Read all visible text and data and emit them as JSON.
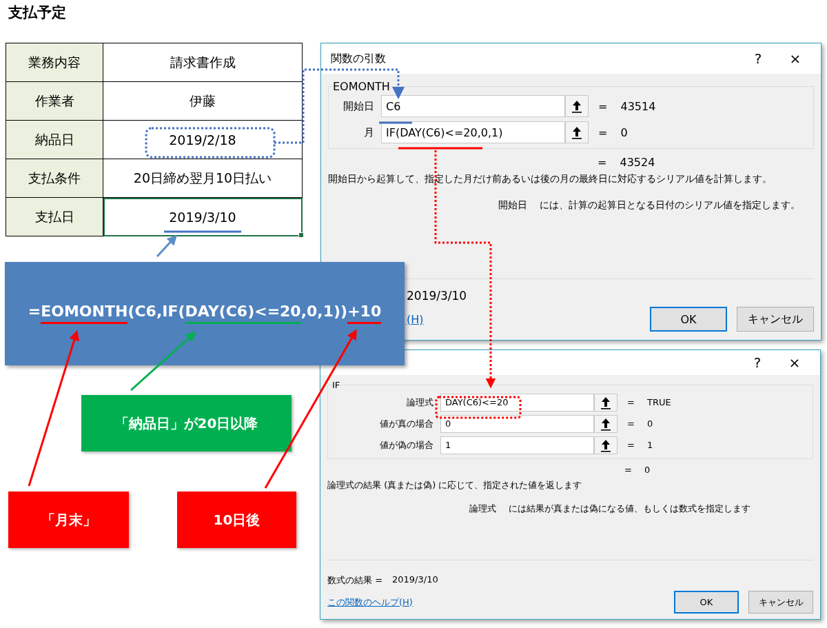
{
  "title": "支払予定",
  "table": {
    "rows": [
      {
        "label": "業務内容",
        "value": "請求書作成",
        "selected": false
      },
      {
        "label": "作業者",
        "value": "伊藤",
        "selected": false
      },
      {
        "label": "納品日",
        "value": "2019/2/18",
        "selected": false
      },
      {
        "label": "支払条件",
        "value": "20日締め翌月10日払い",
        "selected": false
      },
      {
        "label": "支払日",
        "value": "2019/3/10",
        "selected": true
      }
    ]
  },
  "dialogs": [
    {
      "title": "関数の引数",
      "help_mark": "?",
      "close_mark": "×",
      "function": "EOMONTH",
      "args": [
        {
          "label": "開始日",
          "value": "C6",
          "result": "= 43514"
        },
        {
          "label": "月",
          "value": "IF(DAY(C6)<=20,0,1)",
          "result": "= 0"
        }
      ],
      "result": "= 43524",
      "description": "開始日から起算して、指定した月だけ前あるいは後の月の最終日に対応するシリアル値を計算します。",
      "arg_name": "開始日",
      "arg_help": "には、計算の起算日となる日付のシリアル値を指定します。",
      "formula_result": "2019/3/10",
      "help_link": "(H)",
      "buttons": [
        "OK",
        "キャンセル"
      ]
    },
    {
      "help_mark": "?",
      "close_mark": "×",
      "function": "IF",
      "args": [
        {
          "label": "論理式",
          "value": "DAY(C6)<=20",
          "result": "= TRUE"
        },
        {
          "label": "値が真の場合",
          "value": "0",
          "result": "= 0"
        },
        {
          "label": "値が偽の場合",
          "value": "1",
          "result": "= 1"
        }
      ],
      "result": "= 0",
      "description": "論理式の結果 (真または偽) に応じて、指定された値を返します",
      "arg_name": "論理式",
      "arg_help": "には結果が真または偽になる値、もしくは数式を指定します",
      "formula_result_label": "数式の結果 =",
      "formula_result": "2019/3/10",
      "help_link": "この関数のヘルプ(H)",
      "buttons": [
        "OK",
        "キャンセル"
      ]
    }
  ],
  "formula": [
    {
      "text": "="
    },
    {
      "text": "EOMONTH",
      "color": "#ff0000"
    },
    {
      "text": "(C6,IF("
    },
    {
      "text": "DAY(C6)<=20",
      "color": "#00b050"
    },
    {
      "text": ",0,1))"
    },
    {
      "text": "+10",
      "color": "#ff0000"
    }
  ],
  "callouts": [
    {
      "text": "「納品日」が20日以降",
      "color": "#00b050"
    },
    {
      "text": "「月末」",
      "color": "#ff0000"
    },
    {
      "text": "10日後",
      "color": "#ff0000"
    }
  ]
}
